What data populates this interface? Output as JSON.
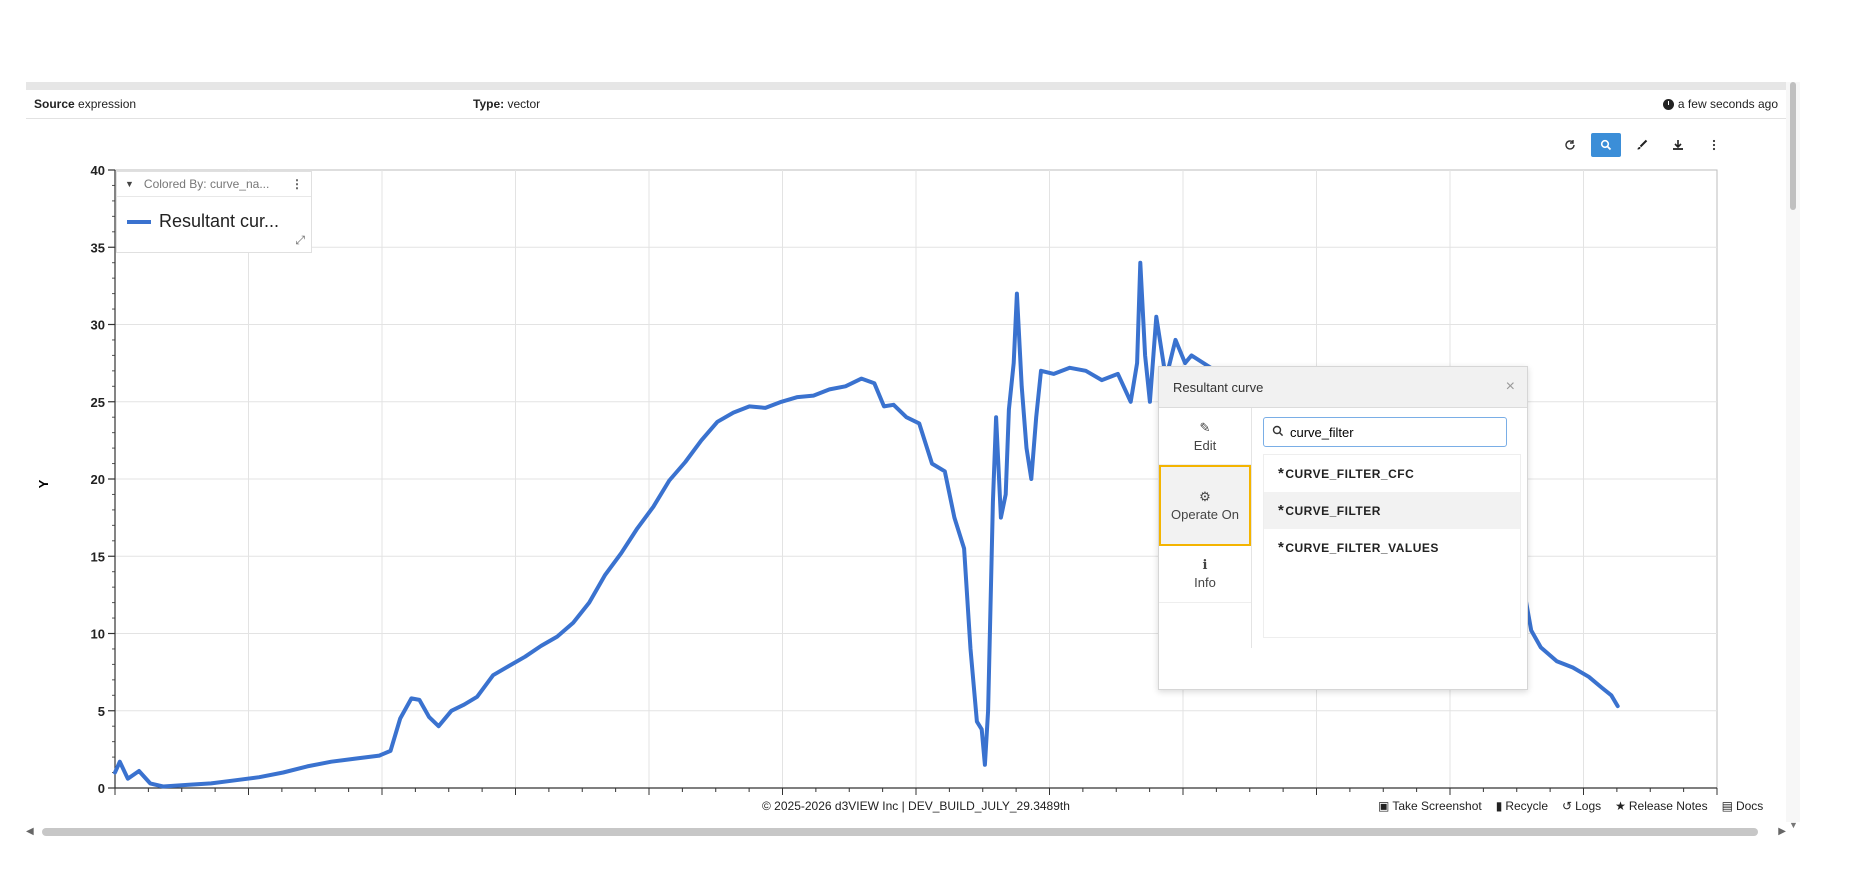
{
  "info": {
    "source_label": "Source",
    "source_value": "expression",
    "type_label": "Type:",
    "type_value": "vector",
    "time": "a few seconds ago"
  },
  "toolbar": {
    "icons": [
      "refresh-icon",
      "zoom-icon",
      "brush-icon",
      "download-icon",
      "more-icon"
    ],
    "active": "zoom-icon"
  },
  "legend": {
    "colored_by": "Colored By: curve_na...",
    "item": "Resultant cur...",
    "color": "#3a72cf"
  },
  "dialog": {
    "title": "Resultant curve",
    "tabs": [
      {
        "label": "Edit",
        "icon": "edit-icon"
      },
      {
        "label": "Operate On",
        "icon": "gear-icon"
      },
      {
        "label": "Info",
        "icon": "info-icon"
      }
    ],
    "selected_tab": "Operate On",
    "search_value": "curve_filter",
    "results": [
      "CURVE_FILTER_CFC",
      "CURVE_FILTER",
      "CURVE_FILTER_VALUES"
    ],
    "result_prefix": "*"
  },
  "footer": {
    "copyright": "© 2025-2026 d3VIEW Inc | DEV_BUILD_JULY_29.3489th",
    "links": [
      "Take Screenshot",
      "Recycle",
      "Logs",
      "Release Notes",
      "Docs"
    ]
  },
  "chart_data": {
    "type": "line",
    "ylabel": "Y",
    "xlabel": "",
    "ylim": [
      0,
      40
    ],
    "yticks": [
      0,
      5,
      10,
      15,
      20,
      25,
      30,
      35,
      40
    ],
    "x_range": [
      0,
      1000
    ],
    "series": [
      {
        "name": "Resultant curve",
        "color": "#3a72cf",
        "points": [
          [
            0,
            1
          ],
          [
            3,
            1.7
          ],
          [
            8,
            0.6
          ],
          [
            15,
            1.1
          ],
          [
            22,
            0.3
          ],
          [
            30,
            0.1
          ],
          [
            45,
            0.2
          ],
          [
            60,
            0.3
          ],
          [
            75,
            0.5
          ],
          [
            90,
            0.7
          ],
          [
            105,
            1.0
          ],
          [
            120,
            1.4
          ],
          [
            135,
            1.7
          ],
          [
            150,
            1.9
          ],
          [
            165,
            2.1
          ],
          [
            172,
            2.4
          ],
          [
            178,
            4.5
          ],
          [
            185,
            5.8
          ],
          [
            190,
            5.7
          ],
          [
            196,
            4.6
          ],
          [
            202,
            4.0
          ],
          [
            210,
            5.0
          ],
          [
            218,
            5.4
          ],
          [
            226,
            5.9
          ],
          [
            236,
            7.3
          ],
          [
            246,
            7.9
          ],
          [
            256,
            8.5
          ],
          [
            266,
            9.2
          ],
          [
            276,
            9.8
          ],
          [
            286,
            10.7
          ],
          [
            296,
            12.0
          ],
          [
            306,
            13.8
          ],
          [
            316,
            15.2
          ],
          [
            326,
            16.8
          ],
          [
            336,
            18.2
          ],
          [
            346,
            19.9
          ],
          [
            356,
            21.1
          ],
          [
            366,
            22.5
          ],
          [
            376,
            23.7
          ],
          [
            386,
            24.3
          ],
          [
            396,
            24.7
          ],
          [
            406,
            24.6
          ],
          [
            416,
            25.0
          ],
          [
            426,
            25.3
          ],
          [
            436,
            25.4
          ],
          [
            446,
            25.8
          ],
          [
            456,
            26.0
          ],
          [
            466,
            26.5
          ],
          [
            474,
            26.2
          ],
          [
            480,
            24.7
          ],
          [
            486,
            24.8
          ],
          [
            494,
            24.0
          ],
          [
            502,
            23.6
          ],
          [
            510,
            21.0
          ],
          [
            518,
            20.5
          ],
          [
            524,
            17.5
          ],
          [
            530,
            15.5
          ],
          [
            534,
            9.0
          ],
          [
            538,
            4.3
          ],
          [
            541,
            3.8
          ],
          [
            543,
            1.5
          ],
          [
            545,
            5.0
          ],
          [
            548,
            18.5
          ],
          [
            550,
            24.0
          ],
          [
            553,
            17.5
          ],
          [
            556,
            19.0
          ],
          [
            558,
            24.5
          ],
          [
            561,
            27.5
          ],
          [
            563,
            32.0
          ],
          [
            566,
            26.0
          ],
          [
            569,
            22.0
          ],
          [
            572,
            20.0
          ],
          [
            575,
            24.0
          ],
          [
            578,
            27.0
          ],
          [
            586,
            26.8
          ],
          [
            596,
            27.2
          ],
          [
            606,
            27.0
          ],
          [
            616,
            26.4
          ],
          [
            626,
            26.8
          ],
          [
            634,
            25.0
          ],
          [
            638,
            27.5
          ],
          [
            640,
            34.0
          ],
          [
            643,
            28.0
          ],
          [
            646,
            25.0
          ],
          [
            650,
            30.5
          ],
          [
            656,
            26.5
          ],
          [
            662,
            29.0
          ],
          [
            668,
            27.5
          ],
          [
            672,
            28.0
          ],
          [
            875,
            14.5
          ],
          [
            880,
            12.5
          ],
          [
            884,
            10.2
          ],
          [
            890,
            9.1
          ],
          [
            900,
            8.2
          ],
          [
            910,
            7.8
          ],
          [
            920,
            7.2
          ],
          [
            928,
            6.5
          ],
          [
            934,
            6.0
          ],
          [
            938,
            5.3
          ]
        ]
      }
    ]
  }
}
